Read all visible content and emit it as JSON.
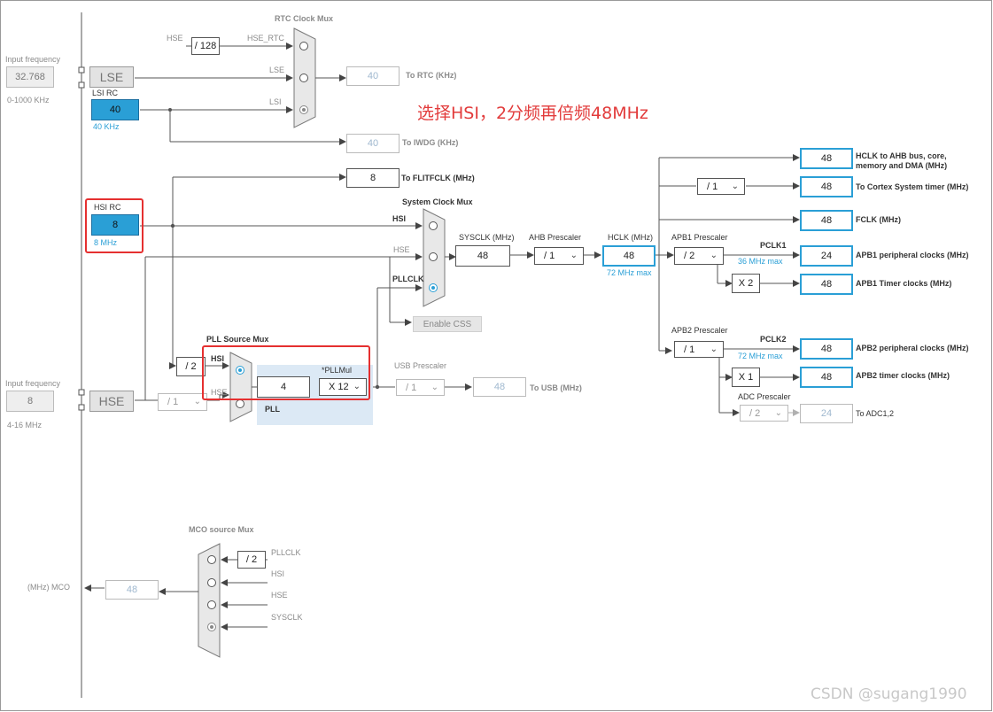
{
  "left": {
    "input_freq_label": "Input frequency",
    "lse_freq": "32.768",
    "lse_range": "0-1000 KHz",
    "lse": "LSE",
    "lsi_rc": "LSI RC",
    "lsi_value": "40",
    "lsi_unit": "40 KHz",
    "hsi_rc": "HSI RC",
    "hsi_value": "8",
    "hsi_unit": "8 MHz",
    "hse_freq": "8",
    "hse_range": "4-16 MHz",
    "hse": "HSE",
    "hse_div": "/ 1"
  },
  "rtc": {
    "title": "RTC Clock Mux",
    "hse_label": "HSE",
    "div128": "/ 128",
    "hse_rtc": "HSE_RTC",
    "lse": "LSE",
    "lsi": "LSI",
    "rtc_value": "40",
    "to_rtc": "To RTC (KHz)",
    "iwdg_value": "40",
    "to_iwdg": "To IWDG (KHz)"
  },
  "flit": {
    "value": "8",
    "label": "To FLITFCLK (MHz)"
  },
  "sysmux": {
    "title": "System Clock Mux",
    "hsi": "HSI",
    "hse": "HSE",
    "pllclk": "PLLCLK",
    "enable_css": "Enable CSS"
  },
  "sysclk": {
    "label": "SYSCLK (MHz)",
    "value": "48"
  },
  "ahb": {
    "label": "AHB Prescaler",
    "value": "/ 1"
  },
  "hclk": {
    "label": "HCLK (MHz)",
    "value": "48",
    "max": "72 MHz max"
  },
  "outputs": {
    "ahb_value": "48",
    "ahb_label": "HCLK to AHB bus, core, memory and DMA (MHz)",
    "cortex_div": "/ 1",
    "cortex_value": "48",
    "cortex_label": "To Cortex System timer (MHz)",
    "fclk_value": "48",
    "fclk_label": "FCLK (MHz)"
  },
  "apb1": {
    "label": "APB1 Prescaler",
    "value": "/ 2",
    "pclk": "PCLK1",
    "max": "36 MHz max",
    "periph_value": "24",
    "periph_label": "APB1 peripheral clocks (MHz)",
    "x": "X 2",
    "timer_value": "48",
    "timer_label": "APB1 Timer clocks (MHz)"
  },
  "apb2": {
    "label": "APB2 Prescaler",
    "value": "/ 1",
    "pclk": "PCLK2",
    "max": "72 MHz max",
    "periph_value": "48",
    "periph_label": "APB2 peripheral clocks (MHz)",
    "x": "X 1",
    "timer_value": "48",
    "timer_label": "APB2 timer clocks (MHz)",
    "adc_label": "ADC Prescaler",
    "adc_div": "/ 2",
    "adc_value": "24",
    "adc_to": "To ADC1,2"
  },
  "pll": {
    "source_title": "PLL Source Mux",
    "div2": "/ 2",
    "hsi": "HSI",
    "hse": "HSE",
    "value": "4",
    "mul_label": "*PLLMul",
    "mul_value": "X 12",
    "label": "PLL"
  },
  "usb": {
    "label": "USB Prescaler",
    "div": "/ 1",
    "value": "48",
    "to": "To USB (MHz)"
  },
  "mco": {
    "title": "MCO source Mux",
    "div2": "/ 2",
    "pllclk": "PLLCLK",
    "hsi": "HSI",
    "hse": "HSE",
    "sysclk": "SYSCLK",
    "value": "48",
    "label": "(MHz) MCO"
  },
  "annotation": "选择HSI，2分频再倍频48MHz",
  "watermark": "CSDN @sugang1990",
  "colors": {
    "accent": "#2a9fd6",
    "highlight": "#e53030",
    "pll_panel": "#dce9f5"
  }
}
